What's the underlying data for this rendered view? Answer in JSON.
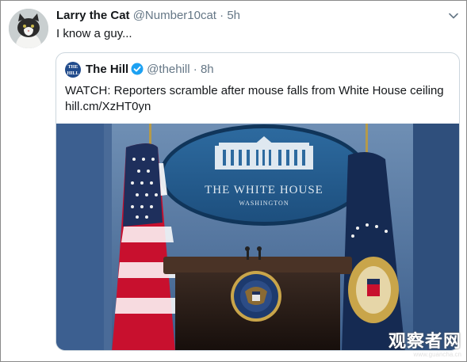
{
  "tweet": {
    "author_name": "Larry the Cat",
    "author_handle": "@Number10cat",
    "separator": "·",
    "time": "5h",
    "text": "I know a guy...",
    "avatar_icon": "cat-avatar",
    "menu_icon": "chevron-down-icon"
  },
  "quoted_tweet": {
    "author_name": "The Hill",
    "author_handle": "@thehill",
    "separator": "·",
    "time": "8h",
    "verified_icon": "verified-badge-icon",
    "avatar_label": "THE HILL",
    "text": "WATCH: Reporters scramble after mouse falls from White House ceiling",
    "link": "hill.cm/XzHT0yn",
    "image": {
      "sign_line1": "THE WHITE HOUSE",
      "sign_line2": "WASHINGTON",
      "seal_text": "SEAL OF THE PRESIDENT OF THE UNITED STATES"
    }
  },
  "watermark": {
    "main": "观察者网",
    "sub": "www.guancha.cn"
  },
  "colors": {
    "text": "#14171a",
    "muted": "#657786",
    "border": "#ccd6dd",
    "verified": "#1da1f2"
  }
}
